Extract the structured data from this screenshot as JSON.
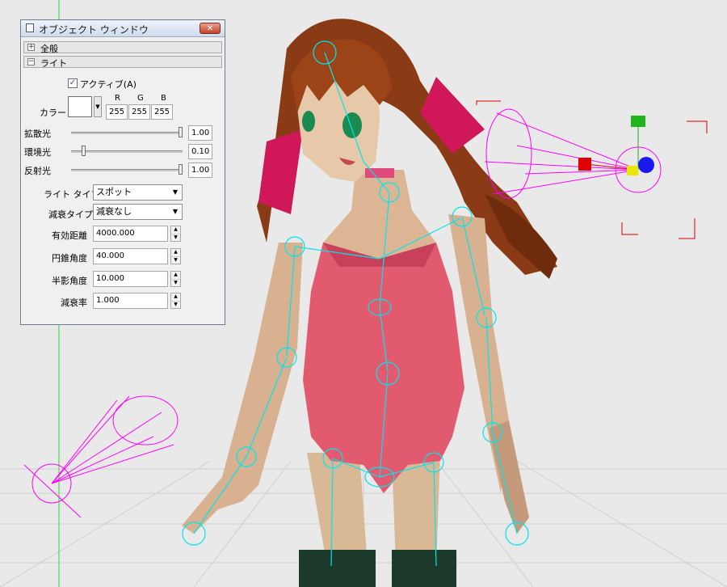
{
  "window": {
    "title": "オブジェクト ウィンドウ",
    "close_label": "✕"
  },
  "sections": {
    "general": {
      "label": "全般",
      "toggle": "+"
    },
    "light": {
      "label": "ライト",
      "toggle": "−"
    }
  },
  "light": {
    "active": {
      "label": "アクティブ(A)",
      "checked": true,
      "mark": "✓"
    },
    "color": {
      "label": "カラー",
      "value": "#ffffff",
      "r_label": "R",
      "g_label": "G",
      "b_label": "B",
      "r": "255",
      "g": "255",
      "b": "255"
    },
    "diffuse": {
      "label": "拡散光",
      "value": "1.00",
      "level": 1.0
    },
    "ambient": {
      "label": "環境光",
      "value": "0.10",
      "level": 0.1
    },
    "specular": {
      "label": "反射光",
      "value": "1.00",
      "level": 1.0
    },
    "light_type": {
      "label": "ライト タイプ",
      "value": "スポット"
    },
    "attenuation_type": {
      "label": "減衰タイプ",
      "value": "減衰なし"
    },
    "effective_distance": {
      "label": "有効距離",
      "value": "4000.000"
    },
    "cone_angle": {
      "label": "円錐角度",
      "value": "40.000"
    },
    "penumbra_angle": {
      "label": "半影角度",
      "value": "10.000"
    },
    "attenuation_rate": {
      "label": "減衰率",
      "value": "1.000"
    }
  },
  "colors": {
    "bone": "#00e5ee",
    "light_gizmo": "#ff00ff",
    "axis_x": "#e00000",
    "axis_y": "#00c000",
    "axis_z": "#0000e0",
    "selection": "#e00000",
    "grid": "#c8c8c8"
  }
}
